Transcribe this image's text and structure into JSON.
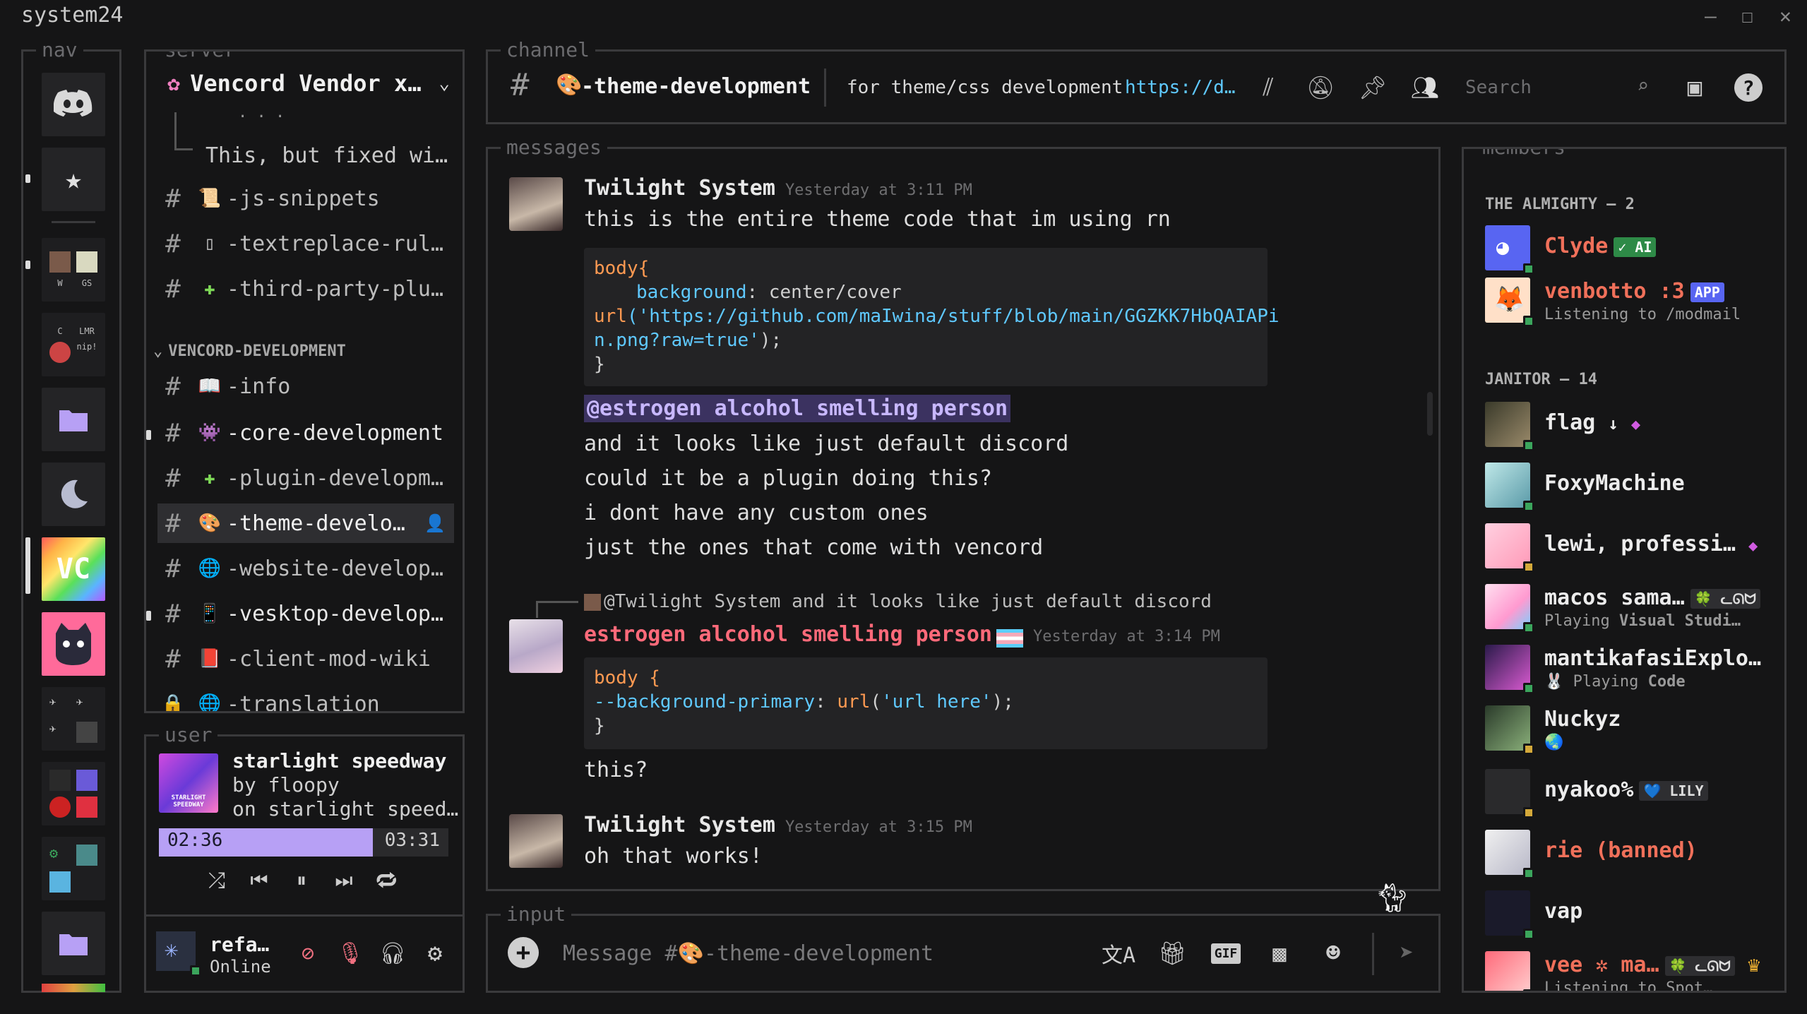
{
  "window": {
    "title": "system24",
    "minimize": "—",
    "maximize": "☐",
    "close": "✕"
  },
  "legends": {
    "nav": "nav",
    "server": "server",
    "channel": "channel",
    "messages": "messages",
    "members": "members",
    "user": "user",
    "input": "input"
  },
  "server": {
    "name": "Vencord Vendor x…",
    "thread_dots": "·    · ·",
    "thread_preview": "This, but fixed wi…",
    "channels": [
      {
        "name": "-js-snippets",
        "emoji": "📜"
      },
      {
        "name": "-textreplace-rul…",
        "emoji": "▯"
      },
      {
        "name": "-third-party-plu…",
        "emoji": "✚"
      }
    ],
    "category": "VENCORD-DEVELOPMENT",
    "category_channels": [
      {
        "name": "-info",
        "emoji": "📖"
      },
      {
        "name": "-core-development",
        "emoji": "👾"
      },
      {
        "name": "-plugin-developm…",
        "emoji": "✚"
      },
      {
        "name": "-theme-develo…",
        "emoji": "🎨"
      },
      {
        "name": "-website-develop…",
        "emoji": "🌐"
      },
      {
        "name": "-vesktop-develop…",
        "emoji": "📱"
      },
      {
        "name": "-client-mod-wiki",
        "emoji": "📕"
      },
      {
        "name": "-translation",
        "emoji": "🌐"
      }
    ]
  },
  "header": {
    "channel": "-theme-development",
    "topic": "for theme/css development",
    "link": "https://d…",
    "search_placeholder": "Search"
  },
  "messages": [
    {
      "author": "Twilight System",
      "time": "Yesterday at 3:11 PM",
      "text": "this is the entire theme code that im using rn",
      "code": {
        "l1": "body{",
        "l2k": "background",
        "l2v": ": center/cover",
        "l3f": "url",
        "l3s": "('https://github.com/maIwina/stuff/blob/main/GGZKK7HbQAIAPi",
        "l4s": "n.png?raw=true'",
        ";": ");",
        "l5": "}"
      },
      "mention": "@estrogen alcohol smelling person",
      "lines": [
        "and it looks like just default discord",
        "could it be a plugin doing this?",
        "i dont have any custom ones",
        "just the ones that come with vencord"
      ]
    },
    {
      "reply_user": "@Twilight System",
      "reply_text": "and it looks like just default discord",
      "author": "estrogen alcohol smelling person",
      "time": "Yesterday at 3:14 PM",
      "code": {
        "l1": "body {",
        "l2k": "--background-primary",
        "l2f": "url",
        "l2s": "'url here'",
        "l3": "}"
      },
      "text": "this?"
    },
    {
      "author": "Twilight System",
      "time": "Yesterday at 3:15 PM",
      "text": "oh that works!"
    }
  ],
  "members": {
    "group1": "THE ALMIGHTY — 2",
    "group2": "JANITOR — 14",
    "list": [
      {
        "name": "Clyde",
        "tag": "✓ AI",
        "color": "#f0705a"
      },
      {
        "name": "venbotto :3",
        "tag": "APP",
        "sub": "Listening to /modmail",
        "color": "#f0705a"
      },
      {
        "name": "flag",
        "extra": "↓",
        "color": "#ececec"
      },
      {
        "name": "FoxyMachine",
        "color": "#ececec"
      },
      {
        "name": "lewi, professi…",
        "color": "#ececec"
      },
      {
        "name": "macos sama…",
        "tag": "🍀 ᓚᘏᗢ",
        "sub_pre": "Playing",
        "sub": "Visual Studi…",
        "color": "#ececec"
      },
      {
        "name": "mantikafasiExplo…",
        "sub_pre": "Playing",
        "sub": "Code",
        "color": "#ececec"
      },
      {
        "name": "Nuckyz",
        "color": "#ececec"
      },
      {
        "name": "nyakoo%",
        "tag": "💙 LILY",
        "color": "#ececec"
      },
      {
        "name": "rie (banned)",
        "color": "#f0705a"
      },
      {
        "name": "vap",
        "color": "#ececec"
      },
      {
        "name": "vee ✲ ma…",
        "tag": "🍀 ᓚᘏᗢ",
        "sub": "Listening to Spot…",
        "color": "#f0705a"
      }
    ]
  },
  "player": {
    "title": "starlight speedway",
    "artist": "by floopy",
    "album": "on starlight speed…",
    "elapsed": "02:36",
    "total": "03:31",
    "progress": 0.74,
    "cover_text": "STARLIGHT SPEEDWAY"
  },
  "user": {
    "name": "refa…",
    "status": "Online"
  },
  "input": {
    "placeholder": "Message #🎨-theme-development"
  },
  "colors": {
    "accent": "#b7a0f5",
    "link": "#5fc9ff",
    "mention_bg": "#3b3260",
    "online": "#3ba55c",
    "idle": "#d4a93a"
  }
}
